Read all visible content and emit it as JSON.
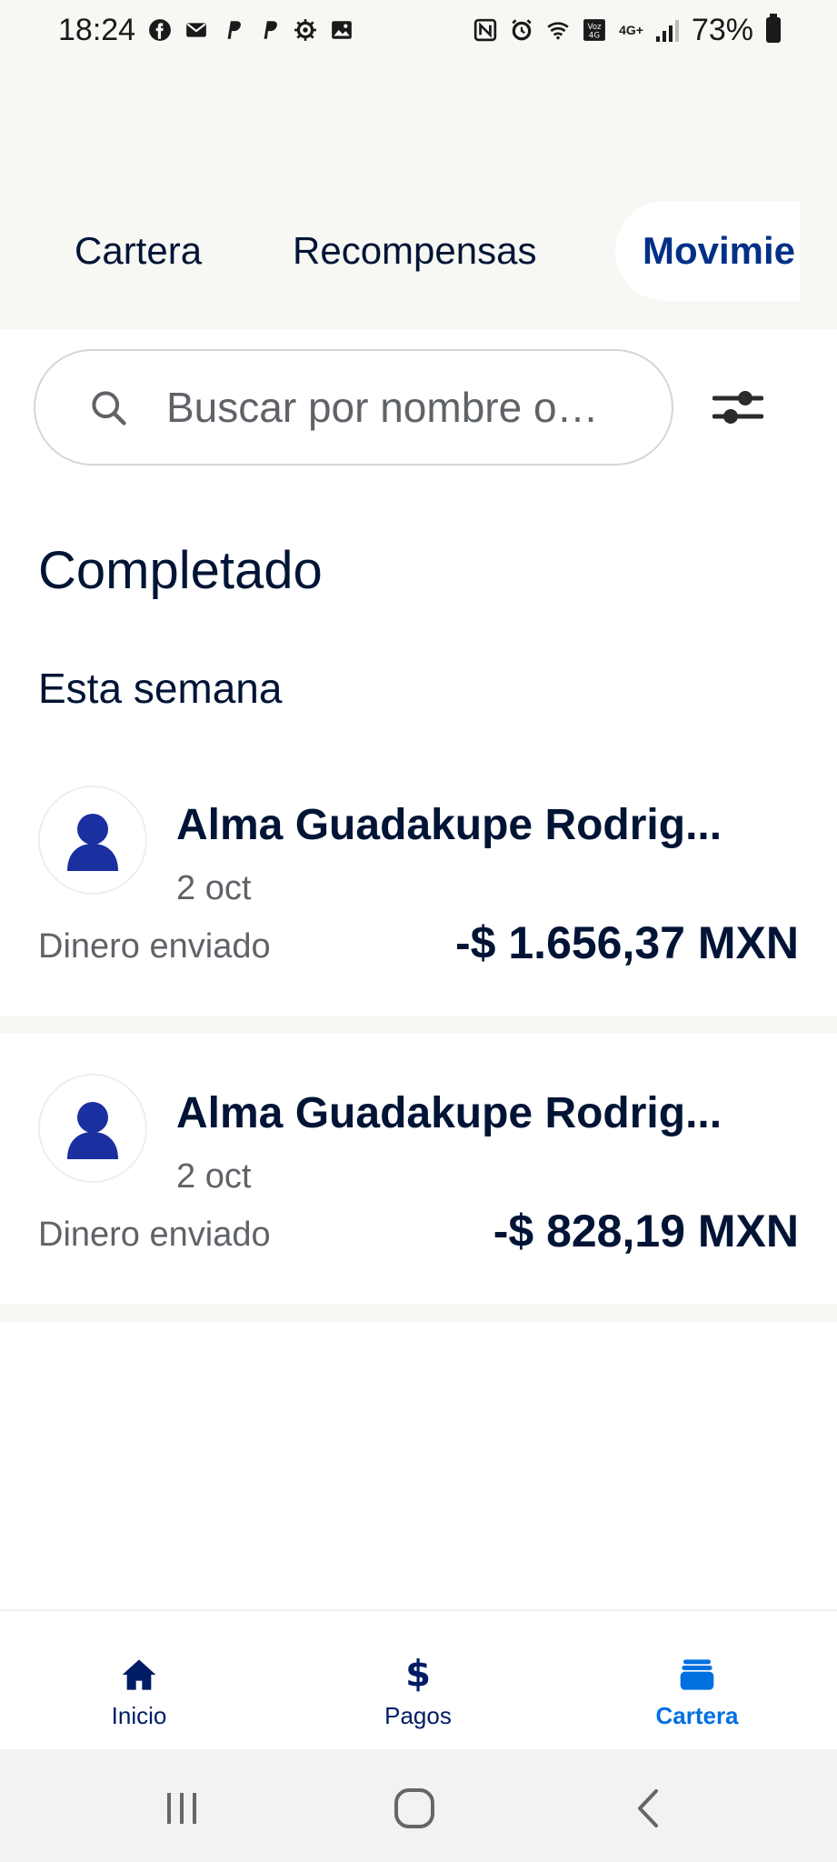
{
  "status_bar": {
    "time": "18:24",
    "battery": "73%",
    "left_icons": [
      "facebook-icon",
      "mail-icon",
      "paypal-icon",
      "paypal-icon",
      "settings-icon",
      "gallery-icon"
    ],
    "right_icons": [
      "nfc-icon",
      "alarm-icon",
      "wifi-icon",
      "volte-icon",
      "4g-icon",
      "signal-icon",
      "battery-icon"
    ],
    "network_badge": "4G+"
  },
  "tabs": [
    {
      "label": "Cartera"
    },
    {
      "label": "Recompensas"
    },
    {
      "label": "Movimie",
      "active": true
    }
  ],
  "search": {
    "placeholder": "Buscar por nombre o…"
  },
  "section_title": "Completado",
  "subsection_title": "Esta semana",
  "transactions": [
    {
      "name": "Alma Guadakupe Rodrig...",
      "date": "2 oct",
      "type": "Dinero enviado",
      "amount": "-$ 1.656,37 MXN"
    },
    {
      "name": "Alma Guadakupe Rodrig...",
      "date": "2 oct",
      "type": "Dinero enviado",
      "amount": "-$ 828,19 MXN"
    }
  ],
  "bottom_nav": [
    {
      "label": "Inicio",
      "icon": "home-icon"
    },
    {
      "label": "Pagos",
      "icon": "dollar-icon"
    },
    {
      "label": "Cartera",
      "icon": "wallet-icon",
      "active": true
    }
  ],
  "colors": {
    "header_bg": "#f7f7f4",
    "text_primary": "#001435",
    "brand_blue": "#003087",
    "active_blue": "#0070e0",
    "avatar_blue": "#1a2fa0"
  }
}
